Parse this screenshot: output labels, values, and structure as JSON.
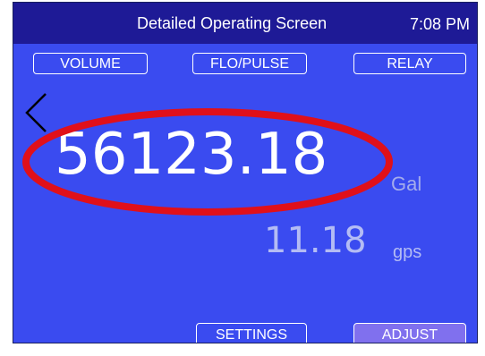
{
  "header": {
    "title": "Detailed Operating Screen",
    "time": "7:08 PM"
  },
  "nav": {
    "volume_label": "VOLUME",
    "flo_pulse_label": "FLO/PULSE",
    "relay_label": "RELAY"
  },
  "back_icon": "chevron-left-icon",
  "reading": {
    "total_value": "56123.18",
    "total_unit": "Gal",
    "rate_value": "11.18",
    "rate_unit": "gps"
  },
  "footer": {
    "settings_label": "SETTINGS",
    "adjust_label": "ADJUST"
  },
  "colors": {
    "screen_background": "#3a4bf0",
    "title_bar": "#1e1a96",
    "adjust_button": "#8070ee",
    "highlight_oval": "#e0101a"
  }
}
